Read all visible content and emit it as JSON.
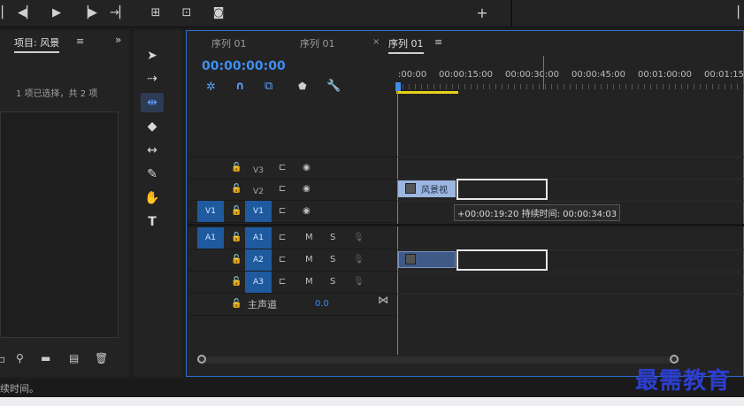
{
  "project": {
    "title": "项目: 风景",
    "selection_info": "1 项已选择，共 2 项"
  },
  "status": {
    "text": "续时间。"
  },
  "timeline": {
    "tabs": [
      {
        "label": "序列 01"
      },
      {
        "label": "序列 01"
      },
      {
        "label": "序列 01"
      }
    ],
    "timecode": "00:00:00:00",
    "ruler_labels": [
      ":00:00",
      "00:00:15:00",
      "00:00:30:00",
      "00:00:45:00",
      "00:01:00:00",
      "00:01:15:0"
    ],
    "tracks": {
      "v3": "V3",
      "v2": "V2",
      "v1_src": "V1",
      "v1": "V1",
      "a1_src": "A1",
      "a1": "A1",
      "a2": "A2",
      "a3": "A3",
      "mute": "M",
      "solo": "S",
      "master": "主声道",
      "master_value": "0.0"
    },
    "clip_label": "风景视",
    "tooltip": "+00:00:19:20 持续时间: 00:00:34:03"
  },
  "watermark": "最需教育",
  "colors": {
    "accent": "#2f6fd0",
    "timecode": "#3d8ef0",
    "clip_video": "#9bb6e0",
    "clip_audio": "#3f5a86",
    "work_area": "#e6d21a"
  }
}
